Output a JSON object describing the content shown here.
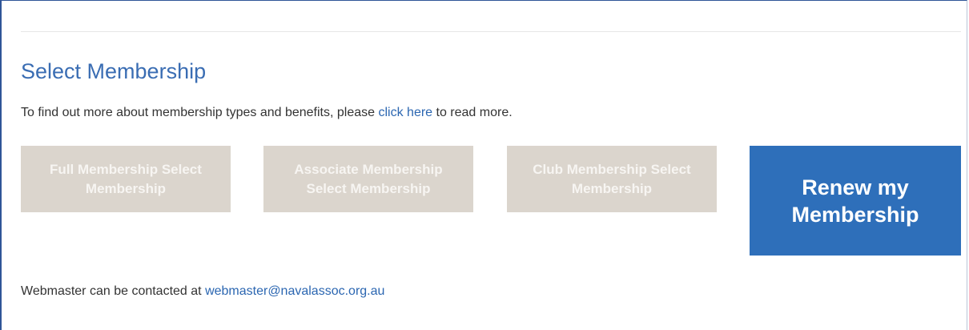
{
  "heading": {
    "title": "Select Membership"
  },
  "info": {
    "prefix": "To find out more about membership types and benefits, please ",
    "link_label": "click here",
    "suffix": " to read more."
  },
  "membership_buttons": [
    {
      "label": "Full Membership Select Membership"
    },
    {
      "label": "Associate Membership Select Membership"
    },
    {
      "label": "Club Membership Select Membership"
    }
  ],
  "renew_button": {
    "label": "Renew my Membership"
  },
  "contact": {
    "prefix": "Webmaster can be contacted at ",
    "email": "webmaster@navalassoc.org.au"
  },
  "colors": {
    "accent": "#3a6db3",
    "link": "#2b66b1",
    "renew_bg": "#2e6fba",
    "disabled_tile_bg": "#dbd5cd",
    "frame_border": "#2f5597"
  }
}
